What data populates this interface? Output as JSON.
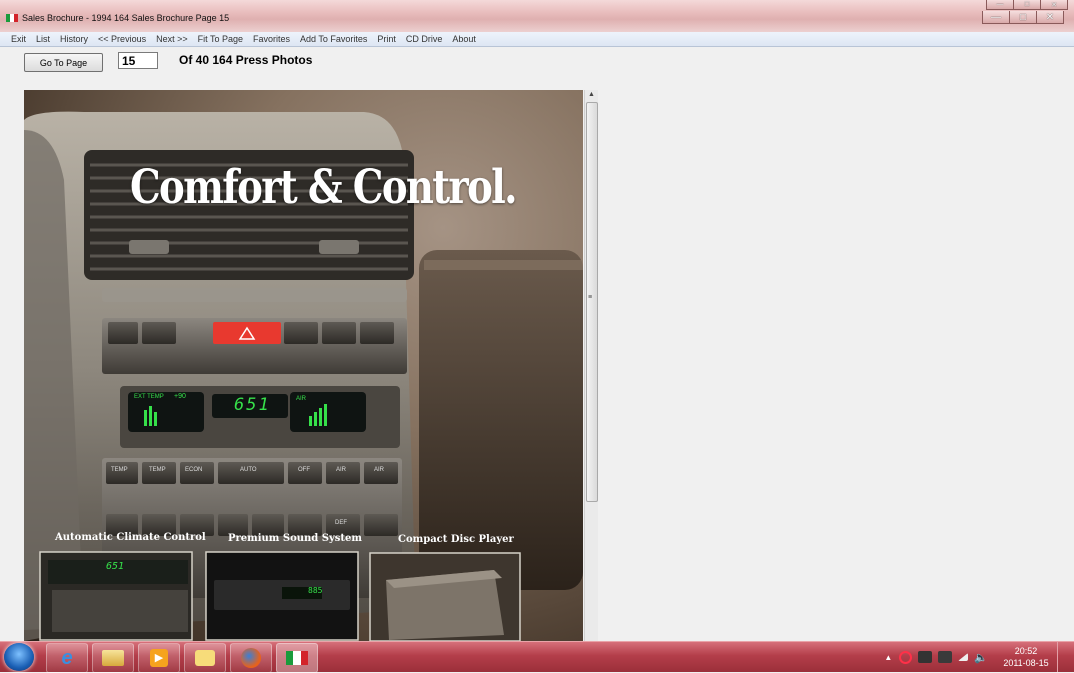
{
  "window": {
    "title": "Sales Brochure - 1994 164 Sales Brochure Page 15",
    "controls": [
      "minimize",
      "maximize",
      "close"
    ],
    "secondary_controls": [
      "minimize",
      "restore",
      "close"
    ]
  },
  "menu": [
    "Exit",
    "List",
    "History",
    "<< Previous",
    "Next >>",
    "Fit To Page",
    "Favorites",
    "Add To Favorites",
    "Print",
    "CD Drive",
    "About"
  ],
  "toolbar": {
    "goto_label": "Go To Page",
    "page_value": "15",
    "of_text": "Of 40 164 Press Photos"
  },
  "brochure": {
    "headline": "Comfort & Control.",
    "display_ext_label": "EXT TEMP",
    "display_ext_value": "+90",
    "display_temp": "651",
    "display_air_label": "AIR",
    "buttons_row1": [
      "TEMP",
      "TEMP",
      "ECON",
      "AUTO",
      "OFF",
      "AIR",
      "AIR"
    ],
    "buttons_row2": [
      "",
      "",
      "",
      "",
      "",
      "",
      "DEF",
      ""
    ],
    "captions": [
      "Automatic Climate Control",
      "Premium Sound System",
      "Compact Disc Player"
    ],
    "radio_readout": "885"
  },
  "taskbar": {
    "apps": [
      "internet-explorer",
      "file-explorer",
      "media-player",
      "messenger",
      "firefox",
      "sales-brochure"
    ],
    "time": "20:52",
    "date": "2011-08-15"
  },
  "colors": {
    "titlebar": "#e8bcbc",
    "taskbar": "#b43e4a",
    "lcd_green": "#36e04a",
    "hazard_red": "#e8392f"
  }
}
